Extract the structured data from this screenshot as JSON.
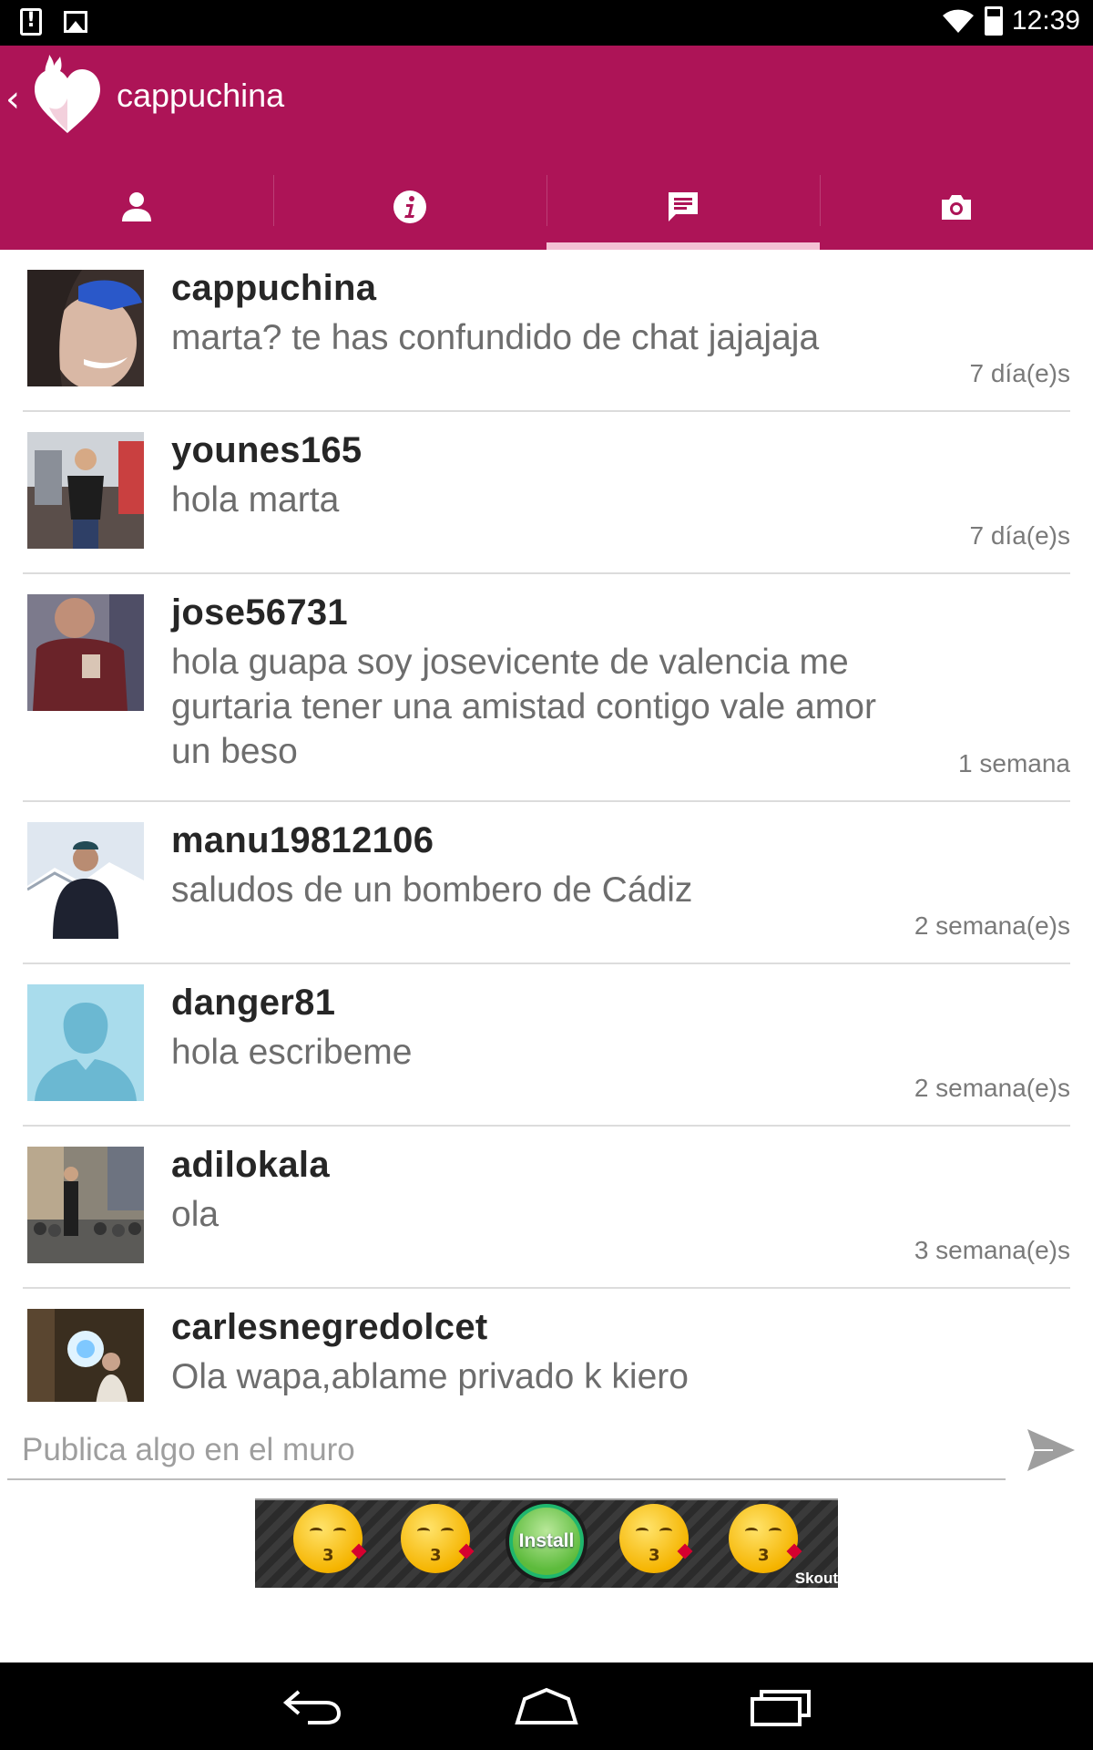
{
  "status_bar": {
    "time": "12:39",
    "left_icons": [
      "alert-icon",
      "image-icon"
    ],
    "right_icons": [
      "wifi-icon",
      "battery-icon"
    ]
  },
  "app_bar": {
    "title": "cappuchina",
    "back_icon": "chevron-left-icon",
    "logo": "flame-heart-logo",
    "accent_color": "#ad1457",
    "tabs": [
      {
        "icon": "person-icon",
        "active": false
      },
      {
        "icon": "info-icon",
        "active": false
      },
      {
        "icon": "chat-icon",
        "active": true
      },
      {
        "icon": "camera-icon",
        "active": false
      }
    ]
  },
  "messages": [
    {
      "user": "cappuchina",
      "text": "marta? te has confundido de chat jajajaja",
      "time": "7 día(e)s"
    },
    {
      "user": "younes165",
      "text": "hola marta",
      "time": "7 día(e)s"
    },
    {
      "user": "jose56731",
      "text": "hola guapa soy josevicente de valencia me gurtaria tener una amistad contigo vale amor un beso",
      "time": "1 semana"
    },
    {
      "user": "manu19812106",
      "text": "saludos de un bombero de Cádiz",
      "time": "2 semana(e)s"
    },
    {
      "user": "danger81",
      "text": "hola escribeme",
      "time": "2 semana(e)s"
    },
    {
      "user": "adilokala",
      "text": "ola",
      "time": "3 semana(e)s"
    },
    {
      "user": "carlesnegredolcet",
      "text": "Ola wapa,ablame privado k kiero",
      "time": ""
    }
  ],
  "composer": {
    "placeholder": "Publica algo en el muro",
    "send_icon": "send-icon"
  },
  "ad": {
    "install_label": "Install",
    "brand": "Skout"
  },
  "nav_bar": {
    "icons": [
      "back-icon",
      "home-icon",
      "recents-icon"
    ]
  }
}
